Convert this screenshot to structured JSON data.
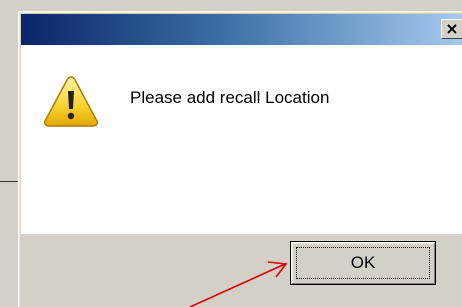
{
  "dialog": {
    "title": "",
    "close_glyph": "×",
    "message": "Please add recall Location",
    "icon": "warning-icon",
    "ok_label": "OK"
  },
  "colors": {
    "titlebar_start": "#0a246a",
    "titlebar_end": "#a6caf0",
    "annotation_arrow": "#e00000"
  },
  "annotation": {
    "type": "arrow",
    "points_to": "ok-button"
  }
}
